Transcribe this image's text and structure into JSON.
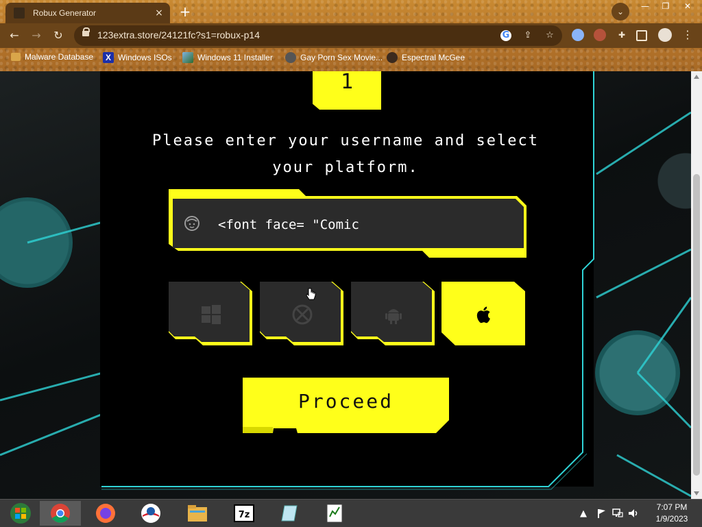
{
  "browser": {
    "tab_title": "Robux Generator",
    "tab_close": "×",
    "new_tab": "+",
    "tab_search": "⌄",
    "window_controls": {
      "minimize": "—",
      "maximize": "❐",
      "close": "✕"
    },
    "nav": {
      "back": "←",
      "forward": "→",
      "reload": "↻"
    },
    "url": "123extra.store/24121fc?s1=robux-p14",
    "omnibox_icons": [
      "google-icon",
      "share-icon",
      "star-icon"
    ],
    "bookmarks": [
      {
        "label": "Malware Database",
        "icon": "folder-icon"
      },
      {
        "label": "Windows ISOs",
        "icon": "x-icon"
      },
      {
        "label": "Windows 11 Installer",
        "icon": "image-icon"
      },
      {
        "label": "Gay Porn Sex Movie...",
        "icon": "site-icon"
      },
      {
        "label": "Espectral McGee",
        "icon": "avatar-icon"
      }
    ]
  },
  "page": {
    "step_number": "1",
    "prompt": "Please enter your username and select your platform.",
    "username_value": "<font face= \"Comic",
    "platforms": [
      {
        "name": "windows",
        "icon": "windows-icon",
        "selected": false
      },
      {
        "name": "xbox",
        "icon": "xbox-icon",
        "selected": false
      },
      {
        "name": "android",
        "icon": "android-icon",
        "selected": false
      },
      {
        "name": "apple",
        "icon": "apple-icon",
        "selected": true
      }
    ],
    "proceed_label": "Proceed",
    "colors": {
      "accent": "#ffff1a",
      "frame": "#2fd3d6",
      "tile": "#2b2b2b"
    }
  },
  "taskbar": {
    "apps": [
      "start-icon",
      "chrome-icon",
      "firefox-icon",
      "obama-icon",
      "explorer-icon",
      "7zip-icon",
      "notepad-icon",
      "editor-icon"
    ],
    "clock_time": "7:07 PM",
    "clock_date": "1/9/2023",
    "tray_arrow": "▲"
  }
}
